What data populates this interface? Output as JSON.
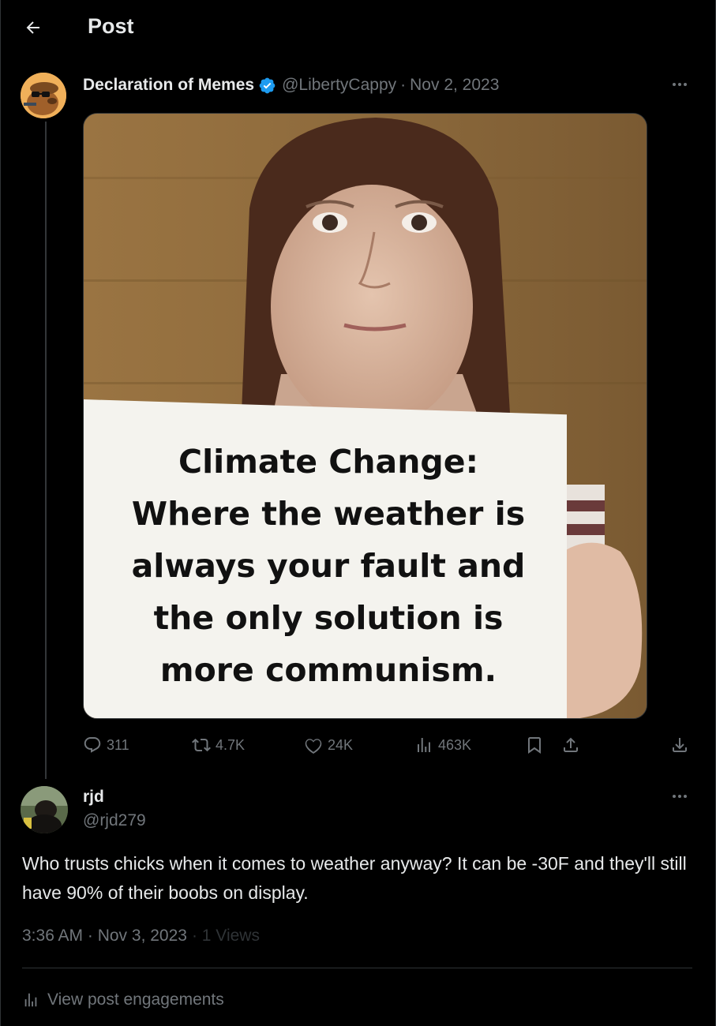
{
  "header": {
    "title": "Post"
  },
  "original_post": {
    "display_name": "Declaration of Memes",
    "handle": "@LibertyCappy",
    "separator": "·",
    "date": "Nov 2, 2023",
    "media": {
      "sign_lines": [
        "Climate Change:",
        "Where the weather is",
        "always your fault and",
        "the only solution is",
        "more communism."
      ]
    },
    "stats": {
      "replies": "311",
      "reposts": "4.7K",
      "likes": "24K",
      "views": "463K"
    }
  },
  "reply": {
    "display_name": "rjd",
    "handle": "@rjd279",
    "text": "Who trusts chicks when it comes to weather anyway? It can be -30F and they'll still have 90% of their boobs on display.",
    "timestamp": "3:36 AM · Nov 3, 2023",
    "views_label": "· 1 Views",
    "engagements_label": "View post engagements"
  },
  "colors": {
    "background": "#000000",
    "text_primary": "#e7e9ea",
    "text_secondary": "#71767b",
    "divider": "#2f3336",
    "verified_blue": "#1d9bf0"
  },
  "icons": [
    "back-arrow-icon",
    "verified-badge-icon",
    "more-icon",
    "reply-icon",
    "repost-icon",
    "like-icon",
    "views-icon",
    "bookmark-icon",
    "share-icon",
    "download-icon",
    "engagements-icon"
  ]
}
